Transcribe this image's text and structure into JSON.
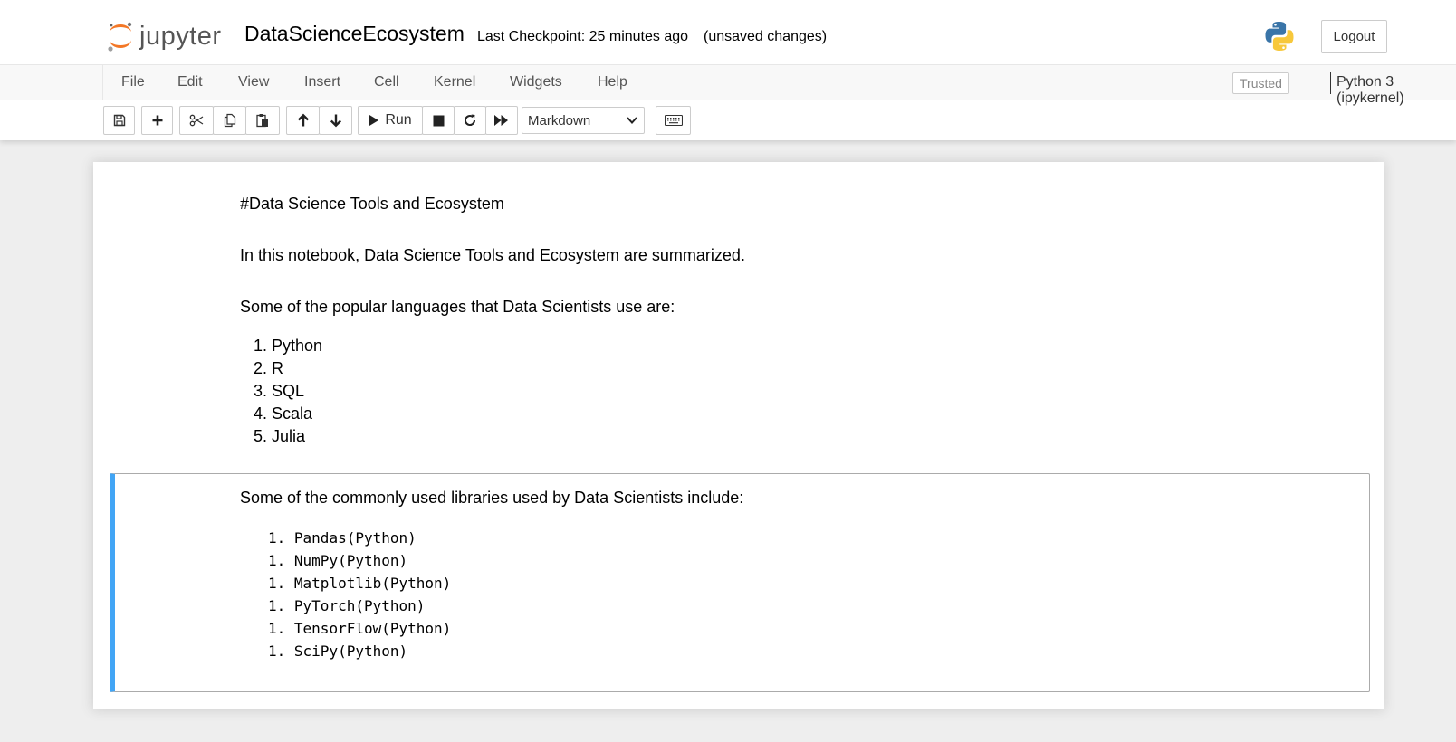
{
  "header": {
    "logo_text": "jupyter",
    "notebook_title": "DataScienceEcosystem",
    "checkpoint": "Last Checkpoint: 25 minutes ago",
    "unsaved": "(unsaved changes)",
    "logout_label": "Logout"
  },
  "menu": {
    "items": [
      "File",
      "Edit",
      "View",
      "Insert",
      "Cell",
      "Kernel",
      "Widgets",
      "Help"
    ],
    "trusted": "Trusted",
    "kernel": "Python 3 (ipykernel)"
  },
  "toolbar": {
    "run_label": "Run",
    "cell_type": "Markdown",
    "icons": [
      "save-icon",
      "plus-icon",
      "scissors-icon",
      "copy-icon",
      "paste-icon",
      "arrow-up-icon",
      "arrow-down-icon",
      "play-icon",
      "stop-icon",
      "restart-icon",
      "fast-forward-icon",
      "keyboard-icon"
    ]
  },
  "cells": {
    "heading": "#Data Science Tools and Ecosystem",
    "intro": "In this notebook, Data Science Tools and Ecosystem are summarized.",
    "languages_intro": "Some of the popular languages that Data Scientists use are:",
    "languages": [
      "Python",
      "R",
      "SQL",
      "Scala",
      "Julia"
    ],
    "libraries_intro": "Some of the commonly used libraries used by Data Scientists include:",
    "libraries": [
      "Pandas(Python)",
      "NumPy(Python)",
      "Matplotlib(Python)",
      "PyTorch(Python)",
      "TensorFlow(Python)",
      "SciPy(Python)"
    ]
  },
  "colors": {
    "selected_cell_bar": "#42a5f5",
    "jupyter_orange": "#f37726"
  }
}
